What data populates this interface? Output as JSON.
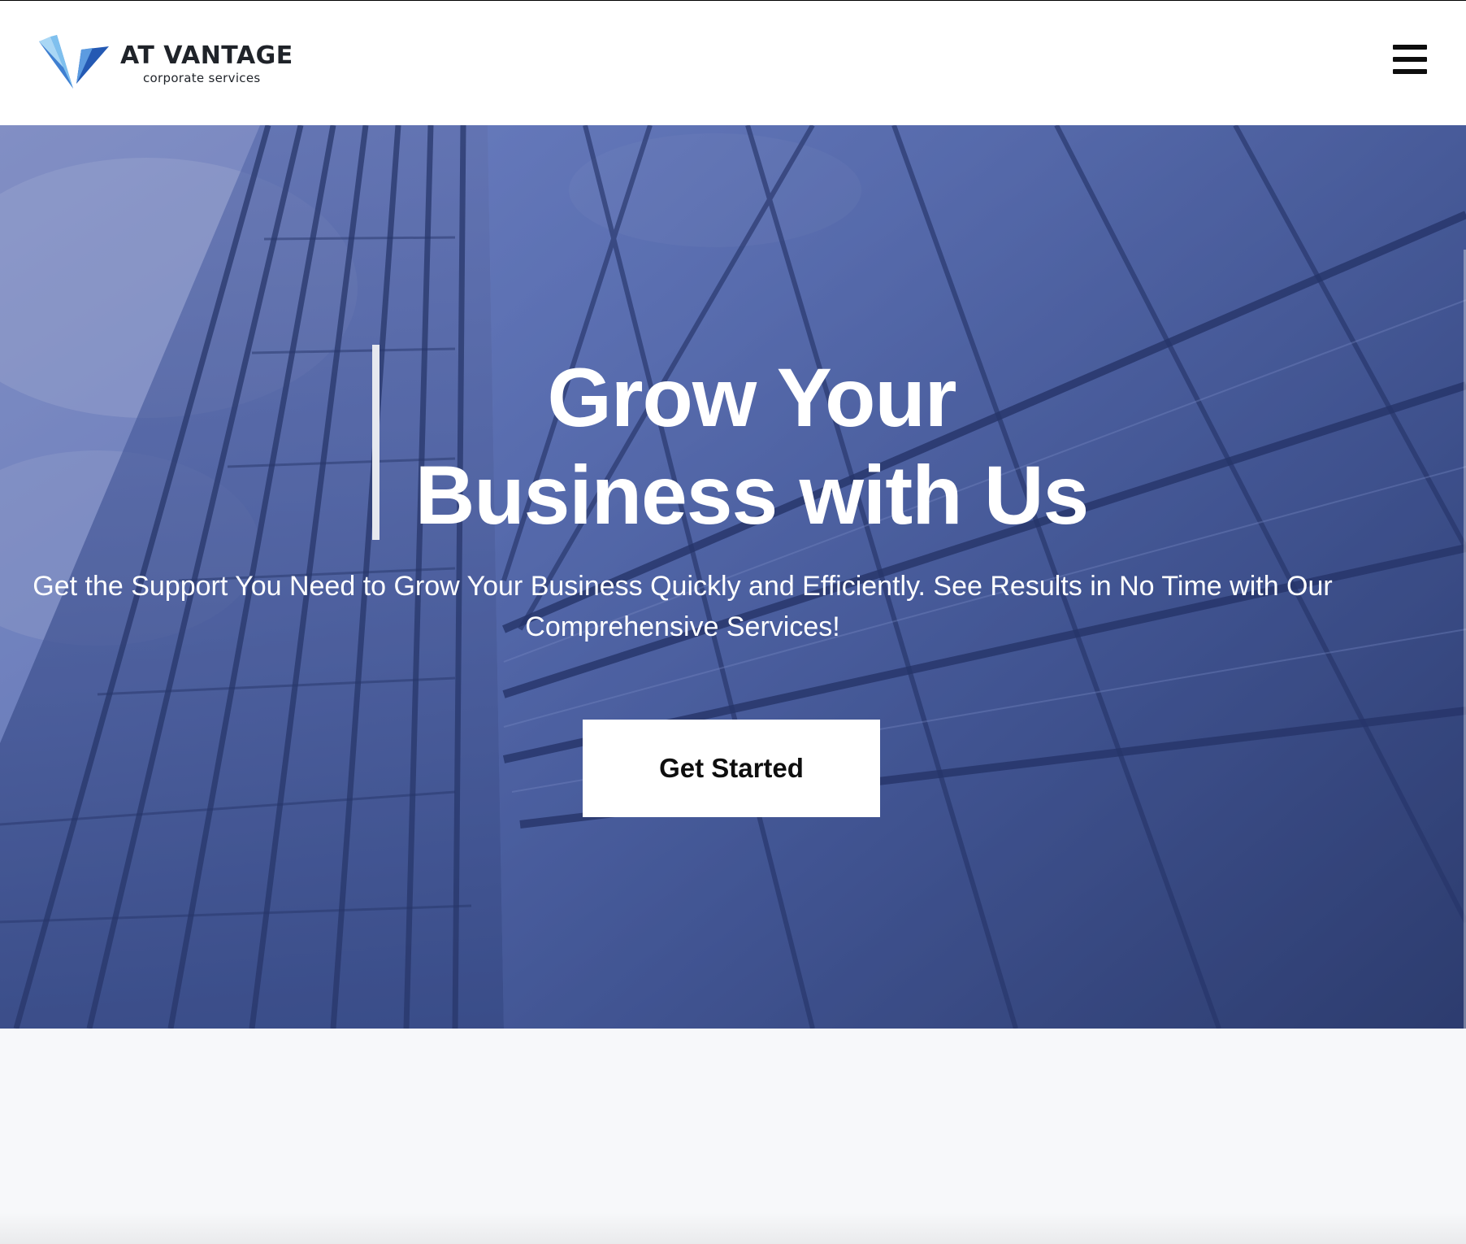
{
  "brand": {
    "name": "AT VANTAGE",
    "tagline": "corporate services",
    "logo_icon": "diamond-v-icon"
  },
  "header": {
    "menu_icon": "hamburger-menu-icon"
  },
  "hero": {
    "title_line1": "Grow Your",
    "title_line2": "Business with Us",
    "subtitle_line1": "Get the Support You Need to Grow Your Business Quickly and Efficiently. See Results in No Time with Our",
    "subtitle_line2": "Comprehensive Services!",
    "cta_label": "Get Started",
    "background": "glass-skyscraper-photo"
  },
  "colors": {
    "header_bg": "#ffffff",
    "hero_tint": "#4a5f9e",
    "logo_blue_light": "#6fb1e8",
    "logo_blue_dark": "#1f4fa8",
    "cta_bg": "#ffffff",
    "text_dark": "#1f2329"
  }
}
